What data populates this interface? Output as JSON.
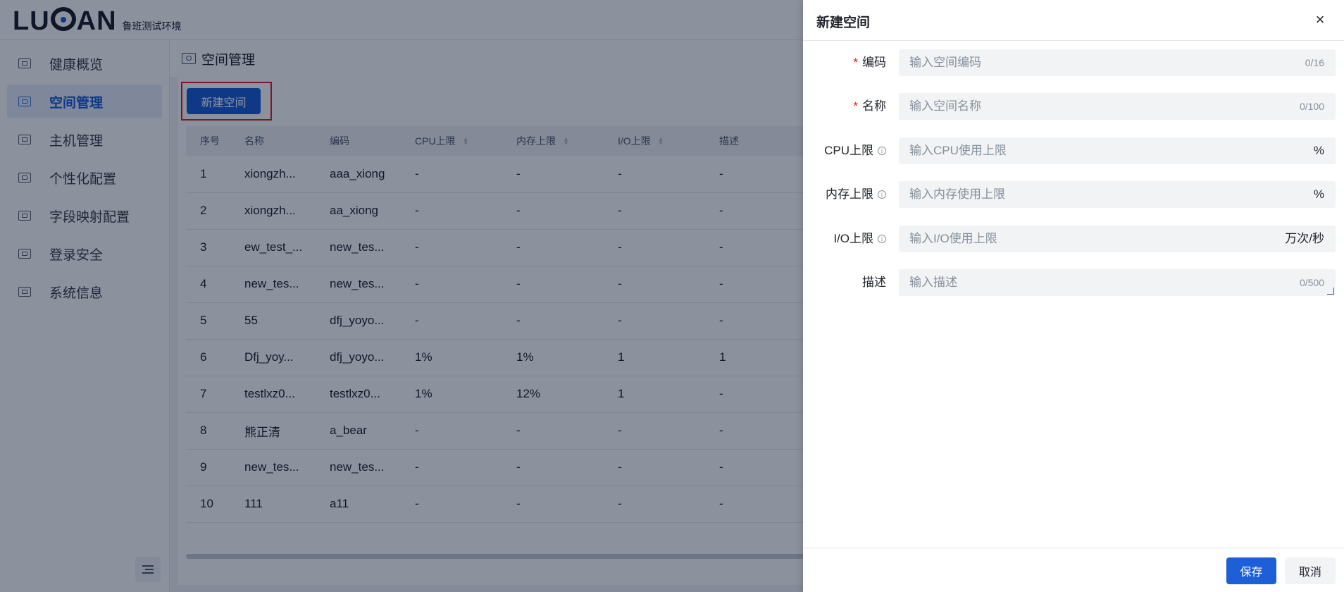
{
  "brand": {
    "logo": "LUBAN",
    "subtitle": "鲁班测试环境"
  },
  "sidebar": {
    "items": [
      {
        "label": "健康概览",
        "icon": "monitor-chart-icon"
      },
      {
        "label": "空间管理",
        "icon": "space-icon",
        "active": true
      },
      {
        "label": "主机管理",
        "icon": "host-icon"
      },
      {
        "label": "个性化配置",
        "icon": "config-icon"
      },
      {
        "label": "字段映射配置",
        "icon": "mapping-icon"
      },
      {
        "label": "登录安全",
        "icon": "security-icon"
      },
      {
        "label": "系统信息",
        "icon": "info-icon"
      }
    ]
  },
  "page": {
    "title": "空间管理",
    "new_button": "新建空间"
  },
  "table": {
    "headers": [
      "序号",
      "名称",
      "编码",
      "CPU上限",
      "内存上限",
      "I/O上限",
      "描述"
    ],
    "rows": [
      [
        "1",
        "xiongzh...",
        "aaa_xiong",
        "-",
        "-",
        "-",
        "-"
      ],
      [
        "2",
        "xiongzh...",
        "aa_xiong",
        "-",
        "-",
        "-",
        "-"
      ],
      [
        "3",
        "ew_test_...",
        "new_tes...",
        "-",
        "-",
        "-",
        "-"
      ],
      [
        "4",
        "new_tes...",
        "new_tes...",
        "-",
        "-",
        "-",
        "-"
      ],
      [
        "5",
        "55",
        "dfj_yoyo...",
        "-",
        "-",
        "-",
        "-"
      ],
      [
        "6",
        "Dfj_yoy...",
        "dfj_yoyo...",
        "1%",
        "1%",
        "1",
        "1"
      ],
      [
        "7",
        "testlxz0...",
        "testlxz0...",
        "1%",
        "12%",
        "1",
        "-"
      ],
      [
        "8",
        "熊正清",
        "a_bear",
        "-",
        "-",
        "-",
        "-"
      ],
      [
        "9",
        "new_tes...",
        "new_tes...",
        "-",
        "-",
        "-",
        "-"
      ],
      [
        "10",
        "111",
        "a11",
        "-",
        "-",
        "-",
        "-"
      ]
    ]
  },
  "drawer": {
    "title": "新建空间",
    "close": "×",
    "fields": {
      "code": {
        "label": "编码",
        "placeholder": "输入空间编码",
        "counter": "0/16"
      },
      "name": {
        "label": "名称",
        "placeholder": "输入空间名称",
        "counter": "0/100"
      },
      "cpu": {
        "label": "CPU上限",
        "placeholder": "输入CPU使用上限",
        "unit": "%"
      },
      "mem": {
        "label": "内存上限",
        "placeholder": "输入内存使用上限",
        "unit": "%"
      },
      "io": {
        "label": "I/O上限",
        "placeholder": "输入I/O使用上限",
        "unit": "万次/秒"
      },
      "desc": {
        "label": "描述",
        "placeholder": "输入描述",
        "counter": "0/500"
      }
    },
    "save": "保存",
    "cancel": "取消"
  },
  "colors": {
    "primary": "#1d5fd6",
    "highlight": "#e02020"
  }
}
